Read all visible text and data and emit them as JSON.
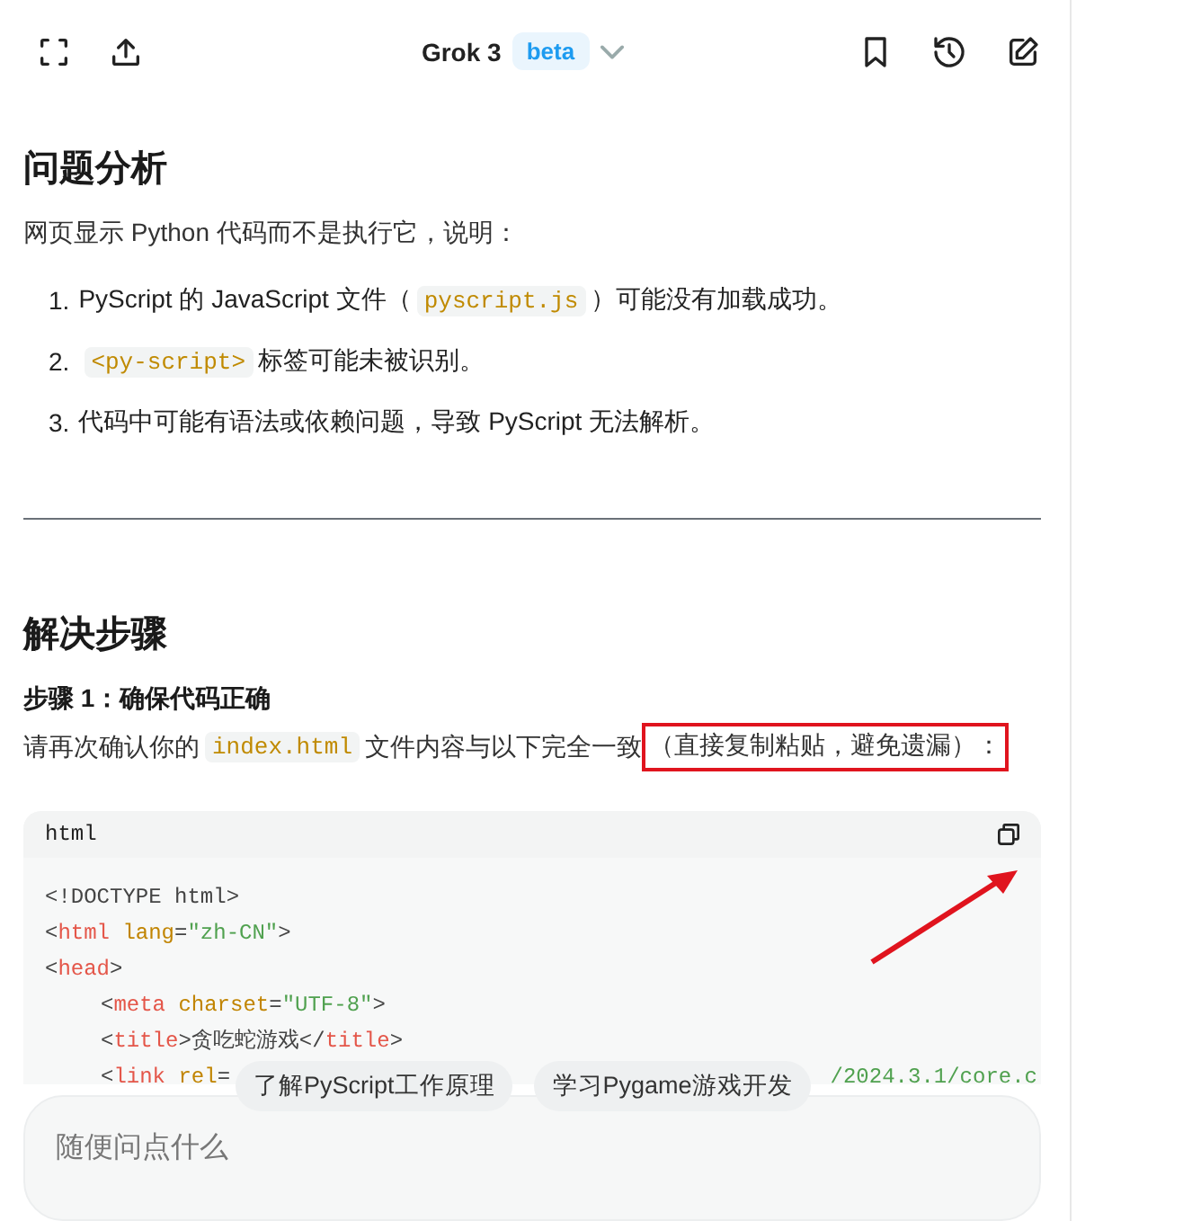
{
  "header": {
    "model": "Grok 3",
    "badge": "beta"
  },
  "sections": [
    {
      "heading": "问题分析",
      "intro": "网页显示 Python 代码而不是执行它，说明：",
      "items": [
        {
          "number": "1.",
          "parts": [
            {
              "kind": "text",
              "text": "PyScript 的 JavaScript 文件（"
            },
            {
              "kind": "code",
              "text": "pyscript.js"
            },
            {
              "kind": "text",
              "text": "）可能没有加载成功。"
            }
          ]
        },
        {
          "number": "2.",
          "parts": [
            {
              "kind": "code",
              "text": "<py-script>"
            },
            {
              "kind": "text",
              "text": "标签可能未被识别。"
            }
          ]
        },
        {
          "number": "3.",
          "parts": [
            {
              "kind": "text",
              "text": "代码中可能有语法或依赖问题，导致 PyScript 无法解析。"
            }
          ]
        }
      ]
    },
    {
      "heading": "解决步骤",
      "step": "步骤 1：确保代码正确",
      "paragraph": [
        {
          "kind": "text",
          "text": "请再次确认你的"
        },
        {
          "kind": "code",
          "text": "index.html"
        },
        {
          "kind": "text",
          "text": "文件内容与以下完全一致"
        },
        {
          "kind": "boxed",
          "text": "（直接复制粘贴，避免遗漏）："
        }
      ]
    }
  ],
  "code": {
    "language": "html",
    "lines": [
      {
        "tokens": [
          {
            "kind": "punct",
            "text": "<!DOCTYPE html>"
          }
        ]
      },
      {
        "tokens": [
          {
            "kind": "punct",
            "text": "<"
          },
          {
            "kind": "tag",
            "text": "html"
          },
          {
            "kind": "attr",
            "text": "lang"
          },
          {
            "kind": "punct",
            "text": "="
          },
          {
            "kind": "string",
            "text": "\"zh-CN\""
          },
          {
            "kind": "punct",
            "text": ">"
          }
        ]
      },
      {
        "tokens": [
          {
            "kind": "punct",
            "text": "<"
          },
          {
            "kind": "tag",
            "text": "head"
          },
          {
            "kind": "punct",
            "text": ">"
          }
        ],
        "children": [
          {
            "tokens": [
              {
                "kind": "punct",
                "text": "<"
              },
              {
                "kind": "tag",
                "text": "meta"
              },
              {
                "kind": "attr",
                "text": "charset"
              },
              {
                "kind": "punct",
                "text": "="
              },
              {
                "kind": "string",
                "text": "\"UTF-8\""
              },
              {
                "kind": "punct",
                "text": ">"
              }
            ]
          },
          {
            "tokens": [
              {
                "kind": "punct",
                "text": "<"
              },
              {
                "kind": "tag",
                "text": "title"
              },
              {
                "kind": "punct",
                "text": ">贪吃蛇游戏</"
              },
              {
                "kind": "tag",
                "text": "title"
              },
              {
                "kind": "punct",
                "text": ">"
              }
            ]
          },
          {
            "tokens": [
              {
                "kind": "punct",
                "text": "<"
              },
              {
                "kind": "tag",
                "text": "link"
              },
              {
                "kind": "attr",
                "text": "rel"
              },
              {
                "kind": "punct",
                "text": "="
              }
            ],
            "tail": [
              {
                "kind": "string",
                "text": "/2024.3.1/core.c"
              }
            ]
          }
        ]
      }
    ]
  },
  "suggestions": [
    "了解PyScript工作原理",
    "学习Pygame游戏开发"
  ],
  "input": {
    "placeholder": "随便问点什么"
  }
}
